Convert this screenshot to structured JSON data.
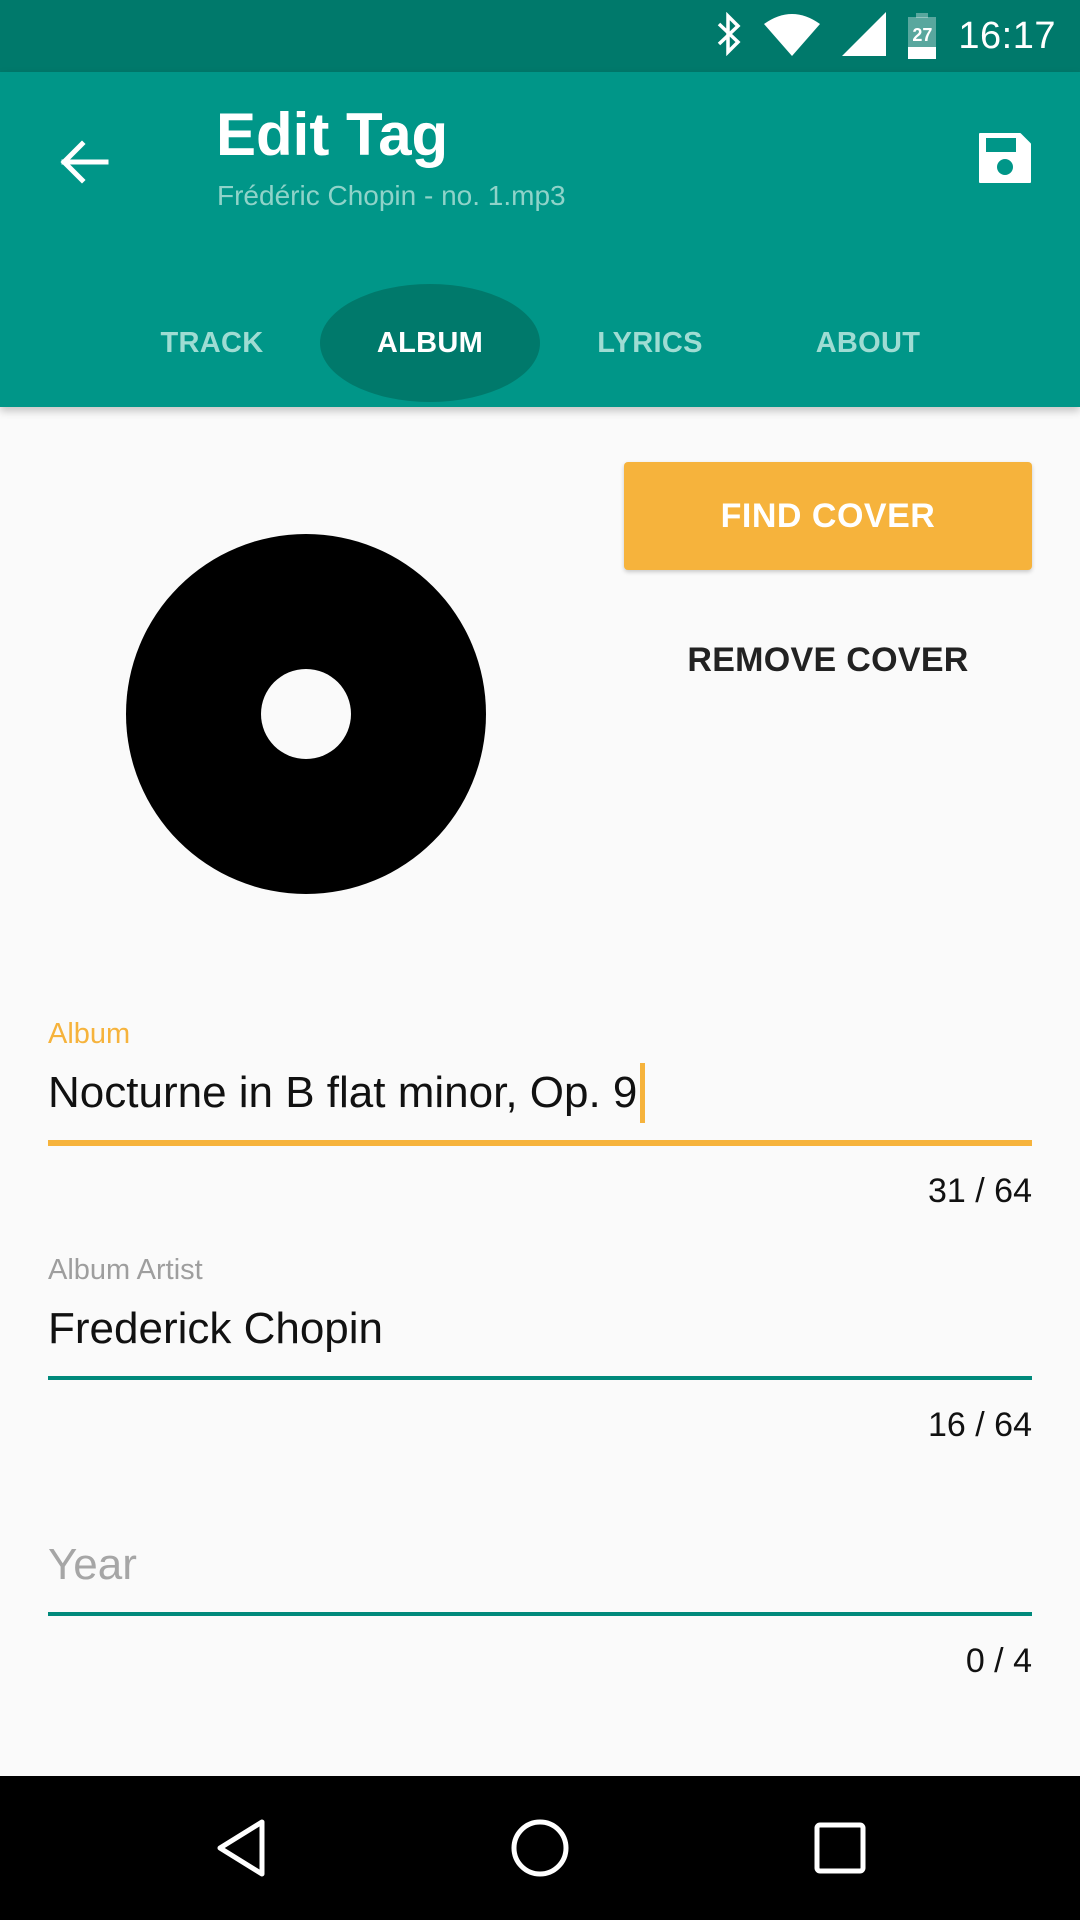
{
  "status_bar": {
    "time": "16:17",
    "battery_level": "27",
    "icons": [
      "bluetooth-icon",
      "wifi-icon",
      "cell-signal-icon",
      "battery-icon"
    ]
  },
  "toolbar": {
    "title": "Edit Tag",
    "subtitle": "Frédéric Chopin - no. 1.mp3",
    "back_icon": "arrow-left-icon",
    "save_icon": "floppy-disk-icon",
    "background_color": "#009688",
    "status_color": "#00796B"
  },
  "tabs": [
    {
      "label": "TRACK",
      "active": false
    },
    {
      "label": "ALBUM",
      "active": true
    },
    {
      "label": "LYRICS",
      "active": false
    },
    {
      "label": "ABOUT",
      "active": false
    }
  ],
  "cover": {
    "placeholder_icon": "disc-icon",
    "find_cover_label": "FIND COVER",
    "remove_cover_label": "REMOVE COVER",
    "accent_color": "#F6B33C"
  },
  "fields": {
    "album": {
      "label": "Album",
      "value": "Nocturne in B flat minor, Op. 9",
      "counter": "31 / 64",
      "focused": true
    },
    "album_artist": {
      "label": "Album Artist",
      "value": "Frederick Chopin",
      "counter": "16 / 64"
    },
    "year": {
      "placeholder": "Year",
      "value": "",
      "counter": "0 / 4"
    }
  },
  "nav_bar": {
    "back_icon": "nav-back-icon",
    "home_icon": "nav-home-icon",
    "recents_icon": "nav-recents-icon"
  }
}
